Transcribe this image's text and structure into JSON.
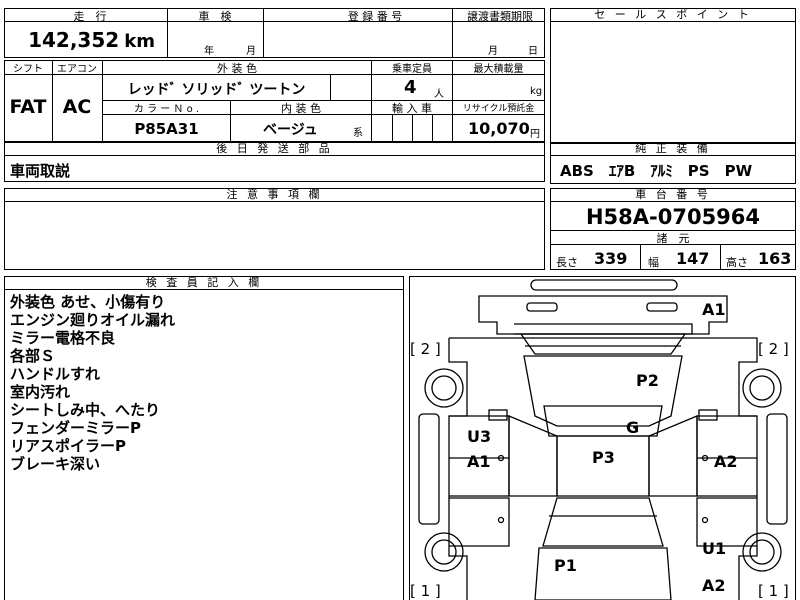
{
  "top_header": {
    "mileage_label": "走　行",
    "inspection_label": "車　検",
    "registration_label": "登 録 番 号",
    "transfer_label": "譲渡書類期限",
    "sales_point_label": "セ ー ル ス ポ イ ン ト"
  },
  "mileage": {
    "value": "142,352",
    "unit": "km"
  },
  "inspection": {
    "year_label": "年",
    "month_label": "月"
  },
  "transfer": {
    "month_label": "月",
    "day_label": "日"
  },
  "spec_header": {
    "shift_label": "シフト",
    "aircon_label": "エアコン",
    "exterior_label": "外 装 色",
    "capacity_label": "乗車定員",
    "max_load_label": "最大積載量"
  },
  "shift": "FAT",
  "aircon": "AC",
  "exterior_color": "レッドﾞ ソリッドﾞ ツートン",
  "capacity": {
    "value": "4",
    "unit": "人"
  },
  "max_load_unit": "kg",
  "color_header": {
    "color_no_label": "カ ラ ー Ｎ o .",
    "interior_label": "内 装 色",
    "import_label": "輸 入 車",
    "recycle_label": "リサイクル預託金"
  },
  "color_no": "P85A31",
  "interior_color": {
    "value": "ベージュ",
    "suffix": "系"
  },
  "recycle_fee": {
    "value": "10,070",
    "unit": "円"
  },
  "later_parts": {
    "label": "後 日 発 送 部 品",
    "value": "車両取説"
  },
  "equipment": {
    "label": "純 正 装 備",
    "value": "ABS　ｴｱB　ｱﾙﾐ　PS　PW"
  },
  "notes": {
    "label": "注 意 事 項 欄"
  },
  "chassis": {
    "label": "車 台 番 号",
    "value": "H58A-0705964"
  },
  "dimensions": {
    "label": "諸　元",
    "length_label": "長さ",
    "length": "339",
    "width_label": "幅",
    "width": "147",
    "height_label": "高さ",
    "height": "163"
  },
  "inspector": {
    "label": "検 査 員 記 入 欄",
    "lines": [
      "外装色 あせ、小傷有り",
      "エンジン廻りオイル漏れ",
      "ミラー電格不良",
      "各部Ｓ",
      "ハンドルすれ",
      "室内汚れ",
      "シートしみ中、へたり",
      "フェンダーミラーP",
      "リアスポイラーP",
      "ブレーキ深い"
    ]
  },
  "diagram": {
    "marks": [
      "A1",
      "P2",
      "G",
      "U3",
      "A1",
      "P3",
      "A2",
      "U1",
      "P1",
      "A2"
    ],
    "brackets": [
      "[ 2 ]",
      "[ 2 ]",
      "[ 1 ]",
      "[ 1 ]"
    ]
  }
}
